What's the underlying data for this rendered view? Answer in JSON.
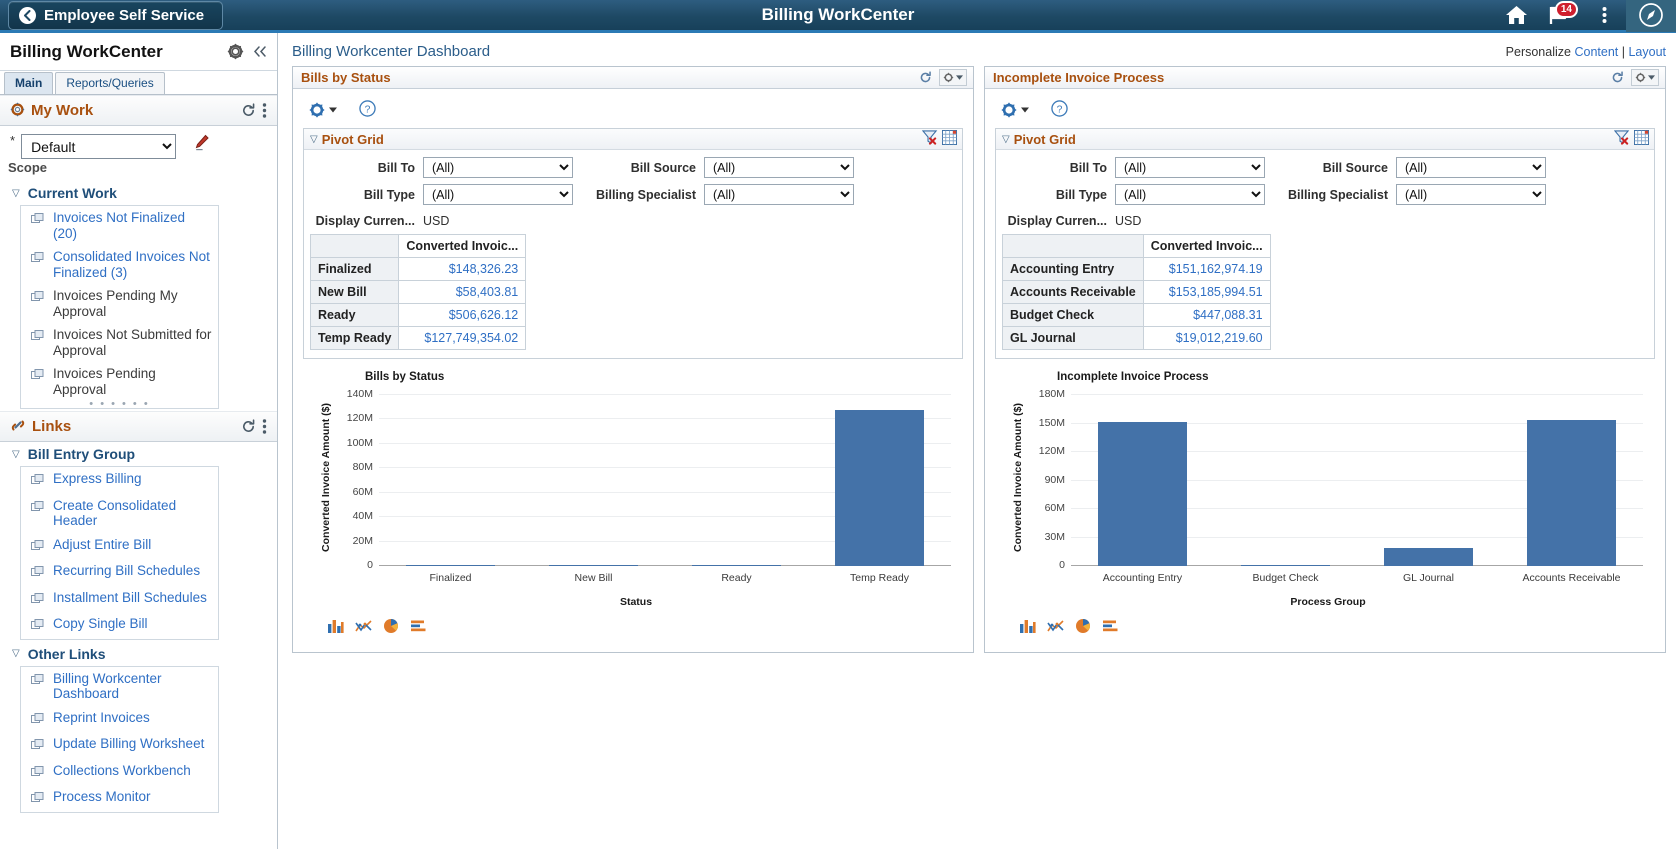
{
  "topbar": {
    "back_label": "Employee Self Service",
    "title": "Billing WorkCenter",
    "notification_count": "14",
    "icons": {
      "home": "home-icon",
      "flag": "notifications-flag-icon",
      "actions": "actions-kebab-icon",
      "nav": "nav-compass-icon"
    }
  },
  "sidebar": {
    "title": "Billing WorkCenter",
    "gear_icon": "gear-icon",
    "collapse_icon": "collapse-chevrons-icon",
    "tabs": [
      {
        "label": "Main",
        "active": true
      },
      {
        "label": "Reports/Queries",
        "active": false
      }
    ],
    "my_work": {
      "title": "My Work",
      "refresh_icon": "refresh-icon",
      "menu_icon": "kebab-menu-icon",
      "scope": {
        "required_marker": "*",
        "label": "Scope",
        "value": "Default",
        "options": [
          "Default"
        ],
        "edit_icon": "edit-pencil-icon"
      },
      "section_title": "Current Work",
      "items": [
        {
          "label": "Invoices Not Finalized (20)",
          "link": true
        },
        {
          "label": "Consolidated Invoices Not Finalized (3)",
          "link": true
        },
        {
          "label": "Invoices Pending My Approval",
          "link": false
        },
        {
          "label": "Invoices Not Submitted for Approval",
          "link": false
        },
        {
          "label": "Invoices Pending Approval",
          "link": false
        }
      ]
    },
    "links": {
      "title": "Links",
      "refresh_icon": "refresh-icon",
      "menu_icon": "kebab-menu-icon",
      "groups": [
        {
          "title": "Bill Entry Group",
          "items": [
            {
              "label": "Express Billing"
            },
            {
              "label": "Create Consolidated Header"
            },
            {
              "label": "Adjust Entire Bill"
            },
            {
              "label": "Recurring Bill Schedules"
            },
            {
              "label": "Installment Bill Schedules"
            },
            {
              "label": "Copy Single Bill"
            }
          ]
        },
        {
          "title": "Other Links",
          "items": [
            {
              "label": "Billing Workcenter Dashboard"
            },
            {
              "label": "Reprint Invoices"
            },
            {
              "label": "Update Billing Worksheet"
            },
            {
              "label": "Collections Workbench"
            },
            {
              "label": "Process Monitor"
            }
          ]
        }
      ]
    }
  },
  "main": {
    "dashboard_title": "Billing Workcenter Dashboard",
    "personalize_prefix": "Personalize",
    "personalize_content": "Content",
    "personalize_separator": "|",
    "personalize_layout": "Layout"
  },
  "panels": [
    {
      "name": "Bills by Status",
      "refresh_icon": "refresh-icon",
      "settings_icon": "gear-icon",
      "dropdown_icon": "chevron-down-icon",
      "toolbar": {
        "gear_icon": "gear-icon",
        "help_icon": "help-question-icon"
      },
      "pivot": {
        "title": "Pivot Grid",
        "collapse_icon": "triangle-down-icon",
        "filter_icon": "clear-filter-icon",
        "grid_icon": "grid-options-icon",
        "filters": [
          {
            "label": "Bill To",
            "value": "(All)",
            "options": [
              "(All)"
            ]
          },
          {
            "label": "Bill Source",
            "value": "(All)",
            "options": [
              "(All)"
            ]
          },
          {
            "label": "Bill Type",
            "value": "(All)",
            "options": [
              "(All)"
            ]
          },
          {
            "label": "Billing Specialist",
            "value": "(All)",
            "options": [
              "(All)"
            ]
          }
        ],
        "currency_label": "Display Curren...",
        "currency_value": "USD",
        "column_header": "Converted Invoic...",
        "rows": [
          {
            "label": "Finalized",
            "value": "$148,326.23"
          },
          {
            "label": "New Bill",
            "value": "$58,403.81"
          },
          {
            "label": "Ready",
            "value": "$506,626.12"
          },
          {
            "label": "Temp Ready",
            "value": "$127,749,354.02"
          }
        ]
      },
      "chart_icons": [
        "bar-chart-icon",
        "line-chart-icon",
        "pie-chart-icon",
        "horizontal-bar-chart-icon"
      ]
    },
    {
      "name": "Incomplete Invoice Process",
      "refresh_icon": "refresh-icon",
      "settings_icon": "gear-icon",
      "dropdown_icon": "chevron-down-icon",
      "toolbar": {
        "gear_icon": "gear-icon",
        "help_icon": "help-question-icon"
      },
      "pivot": {
        "title": "Pivot Grid",
        "collapse_icon": "triangle-down-icon",
        "filter_icon": "clear-filter-icon",
        "grid_icon": "grid-options-icon",
        "filters": [
          {
            "label": "Bill To",
            "value": "(All)",
            "options": [
              "(All)"
            ]
          },
          {
            "label": "Bill Source",
            "value": "(All)",
            "options": [
              "(All)"
            ]
          },
          {
            "label": "Bill Type",
            "value": "(All)",
            "options": [
              "(All)"
            ]
          },
          {
            "label": "Billing Specialist",
            "value": "(All)",
            "options": [
              "(All)"
            ]
          }
        ],
        "currency_label": "Display Curren...",
        "currency_value": "USD",
        "column_header": "Converted Invoic...",
        "rows": [
          {
            "label": "Accounting Entry",
            "value": "$151,162,974.19"
          },
          {
            "label": "Accounts Receivable",
            "value": "$153,185,994.51"
          },
          {
            "label": "Budget Check",
            "value": "$447,088.31"
          },
          {
            "label": "GL Journal",
            "value": "$19,012,219.60"
          }
        ]
      },
      "chart_icons": [
        "bar-chart-icon",
        "line-chart-icon",
        "pie-chart-icon",
        "horizontal-bar-chart-icon"
      ]
    }
  ],
  "chart_data": [
    {
      "type": "bar",
      "title": "Bills by Status",
      "xlabel": "Status",
      "ylabel": "Converted Invoice Amount ($)",
      "categories": [
        "Finalized",
        "New Bill",
        "Ready",
        "Temp Ready"
      ],
      "values": [
        148326.23,
        58403.81,
        506626.12,
        127749354.02
      ],
      "yticks": [
        "0",
        "20M",
        "40M",
        "60M",
        "80M",
        "100M",
        "120M",
        "140M"
      ],
      "ytick_values": [
        0,
        20000000,
        40000000,
        60000000,
        80000000,
        100000000,
        120000000,
        140000000
      ],
      "ylim": [
        0,
        140000000
      ],
      "grid": true,
      "legend": "none",
      "bar_color": "#4472a8"
    },
    {
      "type": "bar",
      "title": "Incomplete Invoice Process",
      "xlabel": "Process Group",
      "ylabel": "Converted Invoice Amount ($)",
      "categories": [
        "Accounting Entry",
        "Budget Check",
        "GL Journal",
        "Accounts Receivable"
      ],
      "values": [
        151162974.19,
        447088.31,
        19012219.6,
        153185994.51
      ],
      "yticks": [
        "0",
        "30M",
        "60M",
        "90M",
        "120M",
        "150M",
        "180M"
      ],
      "ytick_values": [
        0,
        30000000,
        60000000,
        90000000,
        120000000,
        150000000,
        180000000
      ],
      "ylim": [
        0,
        180000000
      ],
      "grid": true,
      "legend": "none",
      "bar_color": "#4472a8"
    }
  ]
}
